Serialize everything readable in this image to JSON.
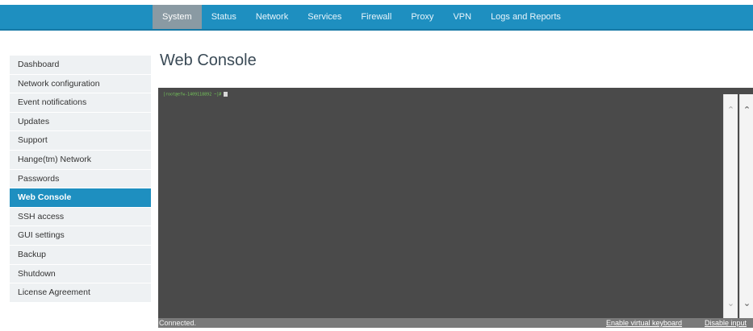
{
  "nav": {
    "items": [
      {
        "label": "System",
        "active": true
      },
      {
        "label": "Status"
      },
      {
        "label": "Network"
      },
      {
        "label": "Services"
      },
      {
        "label": "Firewall"
      },
      {
        "label": "Proxy"
      },
      {
        "label": "VPN"
      },
      {
        "label": "Logs and Reports"
      }
    ]
  },
  "sidebar": {
    "items": [
      {
        "label": "Dashboard"
      },
      {
        "label": "Network configuration"
      },
      {
        "label": "Event notifications"
      },
      {
        "label": "Updates"
      },
      {
        "label": "Support"
      },
      {
        "label": "Hange(tm) Network"
      },
      {
        "label": "Passwords"
      },
      {
        "label": "Web Console",
        "active": true
      },
      {
        "label": "SSH access"
      },
      {
        "label": "GUI settings"
      },
      {
        "label": "Backup"
      },
      {
        "label": "Shutdown"
      },
      {
        "label": "License Agreement"
      }
    ]
  },
  "page": {
    "title": "Web Console"
  },
  "console": {
    "prompt": "[root@efw-1409118892 ~]#",
    "status": "Connected.",
    "enable_keyboard_label": "Enable virtual keyboard",
    "disable_input_label": "Disable input"
  },
  "icons": {
    "scroll_up": "chevron-up-icon",
    "scroll_down": "chevron-down-icon"
  },
  "colors": {
    "accent": "#1e8fc0",
    "console_bg": "#4a4a4a",
    "prompt": "#74c65a"
  }
}
